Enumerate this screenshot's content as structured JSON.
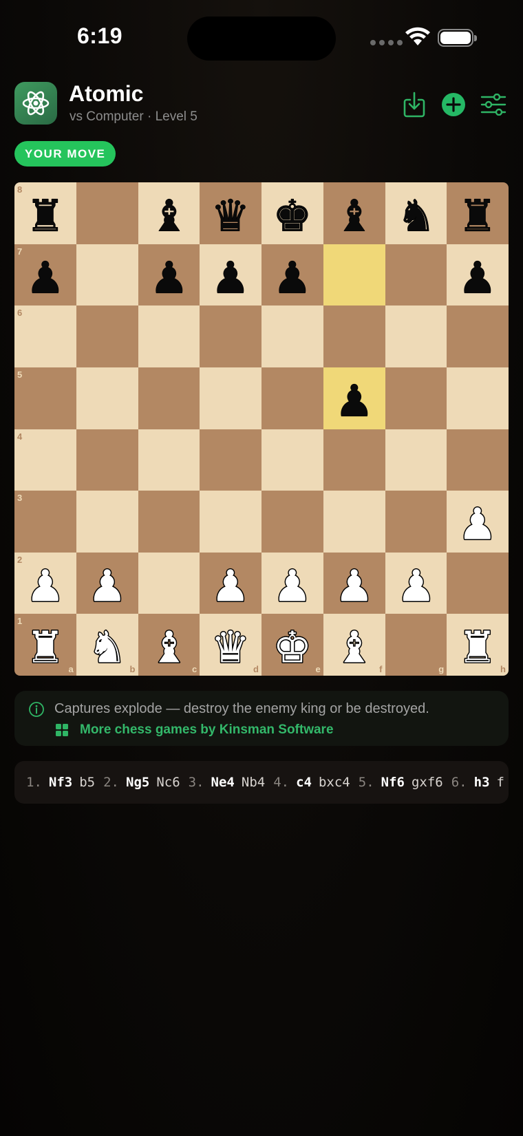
{
  "status_bar": {
    "time": "6:19"
  },
  "header": {
    "title": "Atomic",
    "subtitle": "vs Computer · Level 5",
    "badge": "YOUR MOVE",
    "icons": [
      "atom-icon",
      "download-icon",
      "plus-circle-icon",
      "sliders-icon"
    ]
  },
  "colors": {
    "accent": "#25c45c",
    "light_square": "#eedab7",
    "dark_square": "#b38863",
    "highlight": "#f0d878"
  },
  "board": {
    "files": [
      "a",
      "b",
      "c",
      "d",
      "e",
      "f",
      "g",
      "h"
    ],
    "ranks": [
      "8",
      "7",
      "6",
      "5",
      "4",
      "3",
      "2",
      "1"
    ],
    "position": [
      [
        "r",
        "",
        "b",
        "q",
        "k",
        "b",
        "n",
        "r"
      ],
      [
        "p",
        "",
        "p",
        "p",
        "p",
        "",
        "",
        "p"
      ],
      [
        "",
        "",
        "",
        "",
        "",
        "",
        "",
        ""
      ],
      [
        "",
        "",
        "",
        "",
        "",
        "p",
        "",
        ""
      ],
      [
        "",
        "",
        "",
        "",
        "",
        "",
        "",
        ""
      ],
      [
        "",
        "",
        "",
        "",
        "",
        "",
        "",
        "P"
      ],
      [
        "P",
        "P",
        "",
        "P",
        "P",
        "P",
        "P",
        ""
      ],
      [
        "R",
        "N",
        "B",
        "Q",
        "K",
        "B",
        "",
        "R"
      ]
    ],
    "highlighted": [
      "f7",
      "f5"
    ]
  },
  "info": {
    "text": "Captures explode — destroy the enemy king or be destroyed.",
    "link": "More chess games by Kinsman Software"
  },
  "moves": [
    {
      "num": "1.",
      "white": "Nf3",
      "black": "b5"
    },
    {
      "num": "2.",
      "white": "Ng5",
      "black": "Nc6"
    },
    {
      "num": "3.",
      "white": "Ne4",
      "black": "Nb4"
    },
    {
      "num": "4.",
      "white": "c4",
      "black": "bxc4"
    },
    {
      "num": "5.",
      "white": "Nf6",
      "black": "gxf6"
    },
    {
      "num": "6.",
      "white": "h3",
      "black": "f"
    }
  ]
}
